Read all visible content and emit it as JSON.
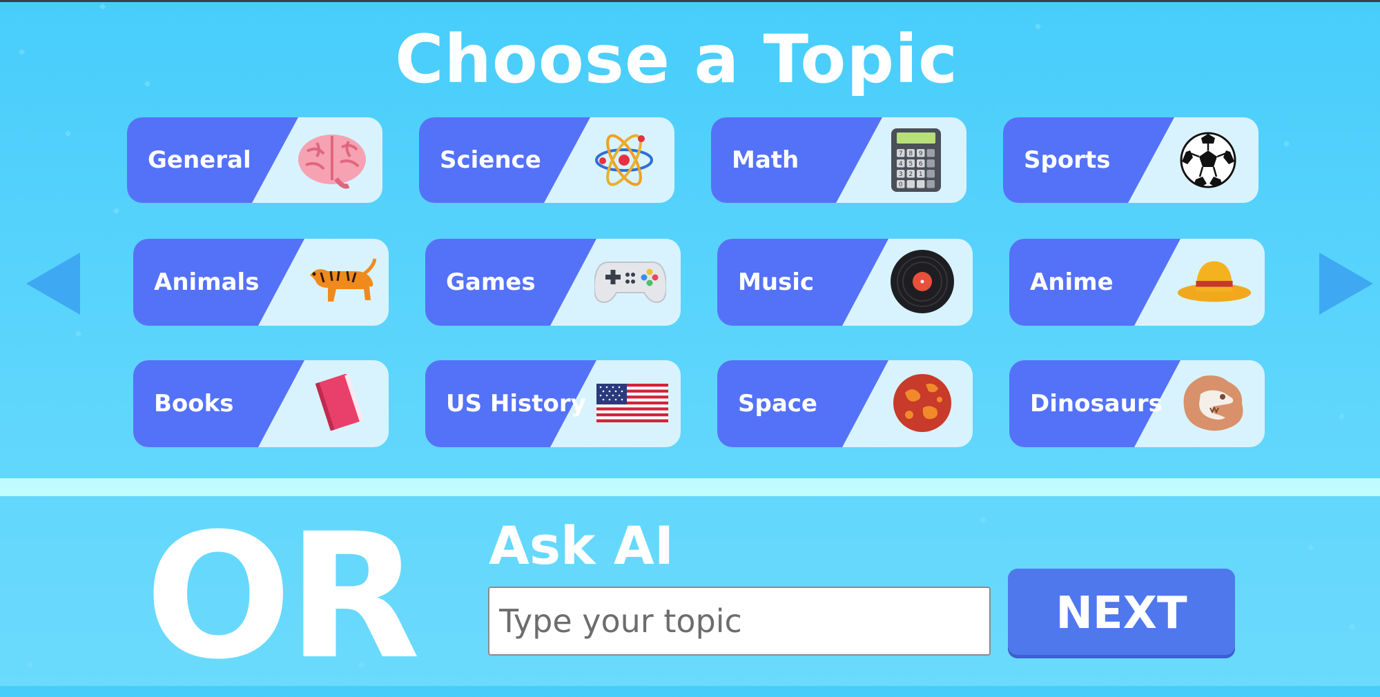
{
  "title": "Choose a Topic",
  "topics": [
    {
      "label": "General",
      "icon": "brain-icon"
    },
    {
      "label": "Science",
      "icon": "atom-icon"
    },
    {
      "label": "Math",
      "icon": "calculator-icon"
    },
    {
      "label": "Sports",
      "icon": "soccer-ball-icon"
    },
    {
      "label": "Animals",
      "icon": "tiger-icon"
    },
    {
      "label": "Games",
      "icon": "gamepad-icon"
    },
    {
      "label": "Music",
      "icon": "vinyl-record-icon"
    },
    {
      "label": "Anime",
      "icon": "straw-hat-icon"
    },
    {
      "label": "Books",
      "icon": "book-icon"
    },
    {
      "label": "US History",
      "icon": "us-flag-icon"
    },
    {
      "label": "Space",
      "icon": "planet-icon"
    },
    {
      "label": "Dinosaurs",
      "icon": "dinosaur-skull-icon"
    }
  ],
  "calculator_keys": [
    "7",
    "8",
    "9",
    "",
    "4",
    "5",
    "6",
    "",
    "3",
    "2",
    "1",
    "",
    "0",
    "",
    "",
    ""
  ],
  "or_label": "OR",
  "ask_ai": {
    "title": "Ask AI",
    "placeholder": "Type your topic",
    "next_label": "NEXT"
  },
  "colors": {
    "background": "#48cdfb",
    "card_band": "#5472f7",
    "card_bg": "#d8f3fe",
    "arrow": "#3ea8f3",
    "divider": "#c0fbff",
    "next_button": "#5078ed"
  }
}
